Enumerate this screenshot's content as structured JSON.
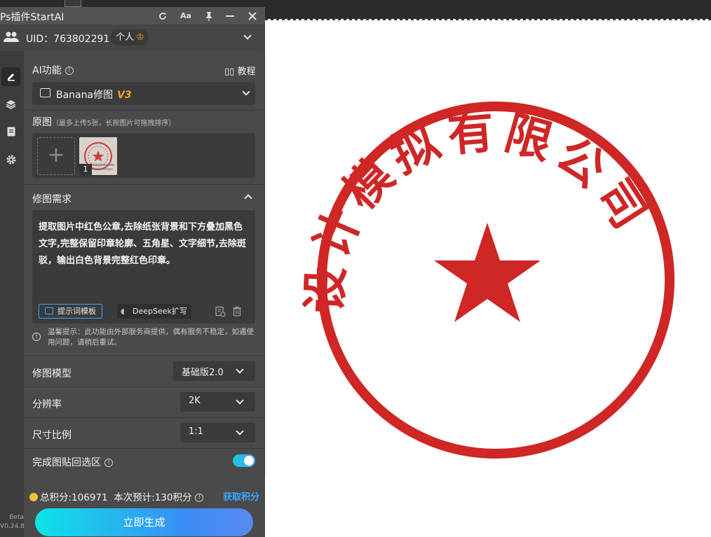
{
  "plugin": {
    "title": "Ps插件StartAI",
    "titlebar_icons": [
      "refresh-icon",
      "font-size-icon",
      "pin-icon",
      "minimize-icon",
      "close-icon"
    ],
    "font_icon_label": "Aa"
  },
  "user": {
    "uid_label": "UID：763802291",
    "badge_label": "个人"
  },
  "sidebar": {
    "items": [
      "edit-icon",
      "layers-icon",
      "document-icon",
      "settings-icon"
    ],
    "version_line1": "Beta",
    "version_line2": "V0.24.8"
  },
  "ai_function": {
    "label": "AI功能",
    "tutorial_label": "教程",
    "selected_value": "Banana修图",
    "selected_badge": "V3"
  },
  "source_image": {
    "label": "原图",
    "hint": "（最多上传5张，长按图片可拖拽排序）",
    "thumb_index": "1"
  },
  "requirements": {
    "label": "修图需求",
    "prompt_text": "提取图片中红色公章,去除纸张背景和下方叠加黑色文字,完整保留印章轮廓、五角星、文字细节,去除斑驳，输出白色背景完整红色印章。",
    "template_button": "提示词模板",
    "deepseek_button": "DeepSeek扩写"
  },
  "notice": {
    "text": "温馨提示：此功能由外部服务商提供，偶有服务不稳定，如遇使用问题，请稍后重试。"
  },
  "settings": {
    "model_label": "修图模型",
    "model_value": "基础版2.0",
    "resolution_label": "分辨率",
    "resolution_value": "2K",
    "ratio_label": "尺寸比例",
    "ratio_value": "1:1",
    "paste_back_label": "完成图贴回选区",
    "paste_back_enabled": true
  },
  "footer": {
    "points_text": "总积分:106971  本次预计:130积分",
    "get_points_label": "获取积分",
    "generate_label": "立即生成"
  },
  "canvas": {
    "seal_text": "设计模拟有限公司",
    "seal_color": "#cf2626"
  },
  "colors": {
    "accent": "#3aa6ff",
    "gold": "#f5a623",
    "seal_red": "#cf2626"
  }
}
